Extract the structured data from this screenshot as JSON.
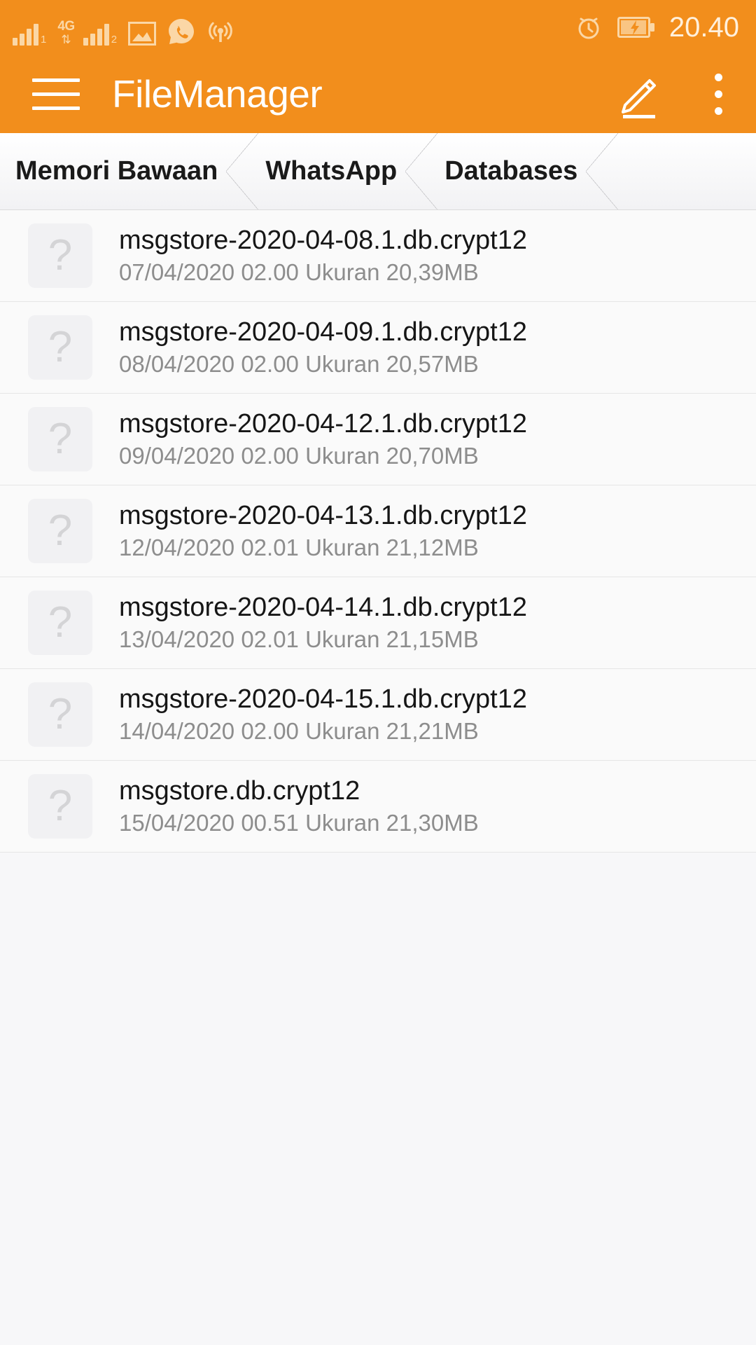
{
  "status_bar": {
    "icons": [
      "signal-bars-sim1-icon",
      "network-4g-icon",
      "signal-bars-sim2-icon",
      "image-icon",
      "whatsapp-call-icon",
      "hotspot-icon"
    ],
    "sim1_label": "1",
    "sim2_label": "2",
    "network_label": "4G",
    "network_arrows": "⇅",
    "alarm_icon": "alarm-clock-icon",
    "battery_icon": "battery-charging-icon",
    "time": "20.40"
  },
  "app_bar": {
    "menu_icon": "hamburger-menu-icon",
    "title": "FileManager",
    "edit_icon": "pencil-edit-icon",
    "overflow_icon": "overflow-menu-icon"
  },
  "breadcrumb": {
    "items": [
      {
        "label": "Memori Bawaan"
      },
      {
        "label": "WhatsApp"
      },
      {
        "label": "Databases"
      }
    ]
  },
  "file_list": {
    "icon_glyph": "?",
    "size_label": "Ukuran",
    "rows": [
      {
        "name": "msgstore-2020-04-08.1.db.crypt12",
        "date": "07/04/2020",
        "time": "02.00",
        "size": "20,39MB",
        "meta": "07/04/2020 02.00  Ukuran 20,39MB"
      },
      {
        "name": "msgstore-2020-04-09.1.db.crypt12",
        "date": "08/04/2020",
        "time": "02.00",
        "size": "20,57MB",
        "meta": "08/04/2020 02.00  Ukuran 20,57MB"
      },
      {
        "name": "msgstore-2020-04-12.1.db.crypt12",
        "date": "09/04/2020",
        "time": "02.00",
        "size": "20,70MB",
        "meta": "09/04/2020 02.00  Ukuran 20,70MB"
      },
      {
        "name": "msgstore-2020-04-13.1.db.crypt12",
        "date": "12/04/2020",
        "time": "02.01",
        "size": "21,12MB",
        "meta": "12/04/2020 02.01  Ukuran 21,12MB"
      },
      {
        "name": "msgstore-2020-04-14.1.db.crypt12",
        "date": "13/04/2020",
        "time": "02.01",
        "size": "21,15MB",
        "meta": "13/04/2020 02.01  Ukuran 21,15MB"
      },
      {
        "name": "msgstore-2020-04-15.1.db.crypt12",
        "date": "14/04/2020",
        "time": "02.00",
        "size": "21,21MB",
        "meta": "14/04/2020 02.00  Ukuran 21,21MB"
      },
      {
        "name": "msgstore.db.crypt12",
        "date": "15/04/2020",
        "time": "00.51",
        "size": "21,30MB",
        "meta": "15/04/2020 00.51  Ukuran 21,30MB"
      }
    ]
  },
  "colors": {
    "accent": "#F28E1C",
    "status_icon": "#FBD7A6",
    "list_bg": "#fafafa",
    "page_bg": "#f7f7f9"
  }
}
